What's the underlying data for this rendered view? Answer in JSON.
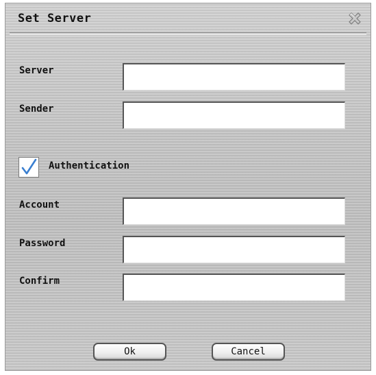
{
  "dialog": {
    "title": "Set Server",
    "close_icon": "close-icon"
  },
  "fields": {
    "server": {
      "label": "Server",
      "value": ""
    },
    "sender": {
      "label": "Sender",
      "value": ""
    },
    "account": {
      "label": "Account",
      "value": ""
    },
    "password": {
      "label": "Password",
      "value": ""
    },
    "confirm": {
      "label": "Confirm",
      "value": ""
    }
  },
  "authentication": {
    "label": "Authentication",
    "checked": true,
    "check_color": "#3a7fd0"
  },
  "buttons": {
    "ok": "Ok",
    "cancel": "Cancel"
  }
}
